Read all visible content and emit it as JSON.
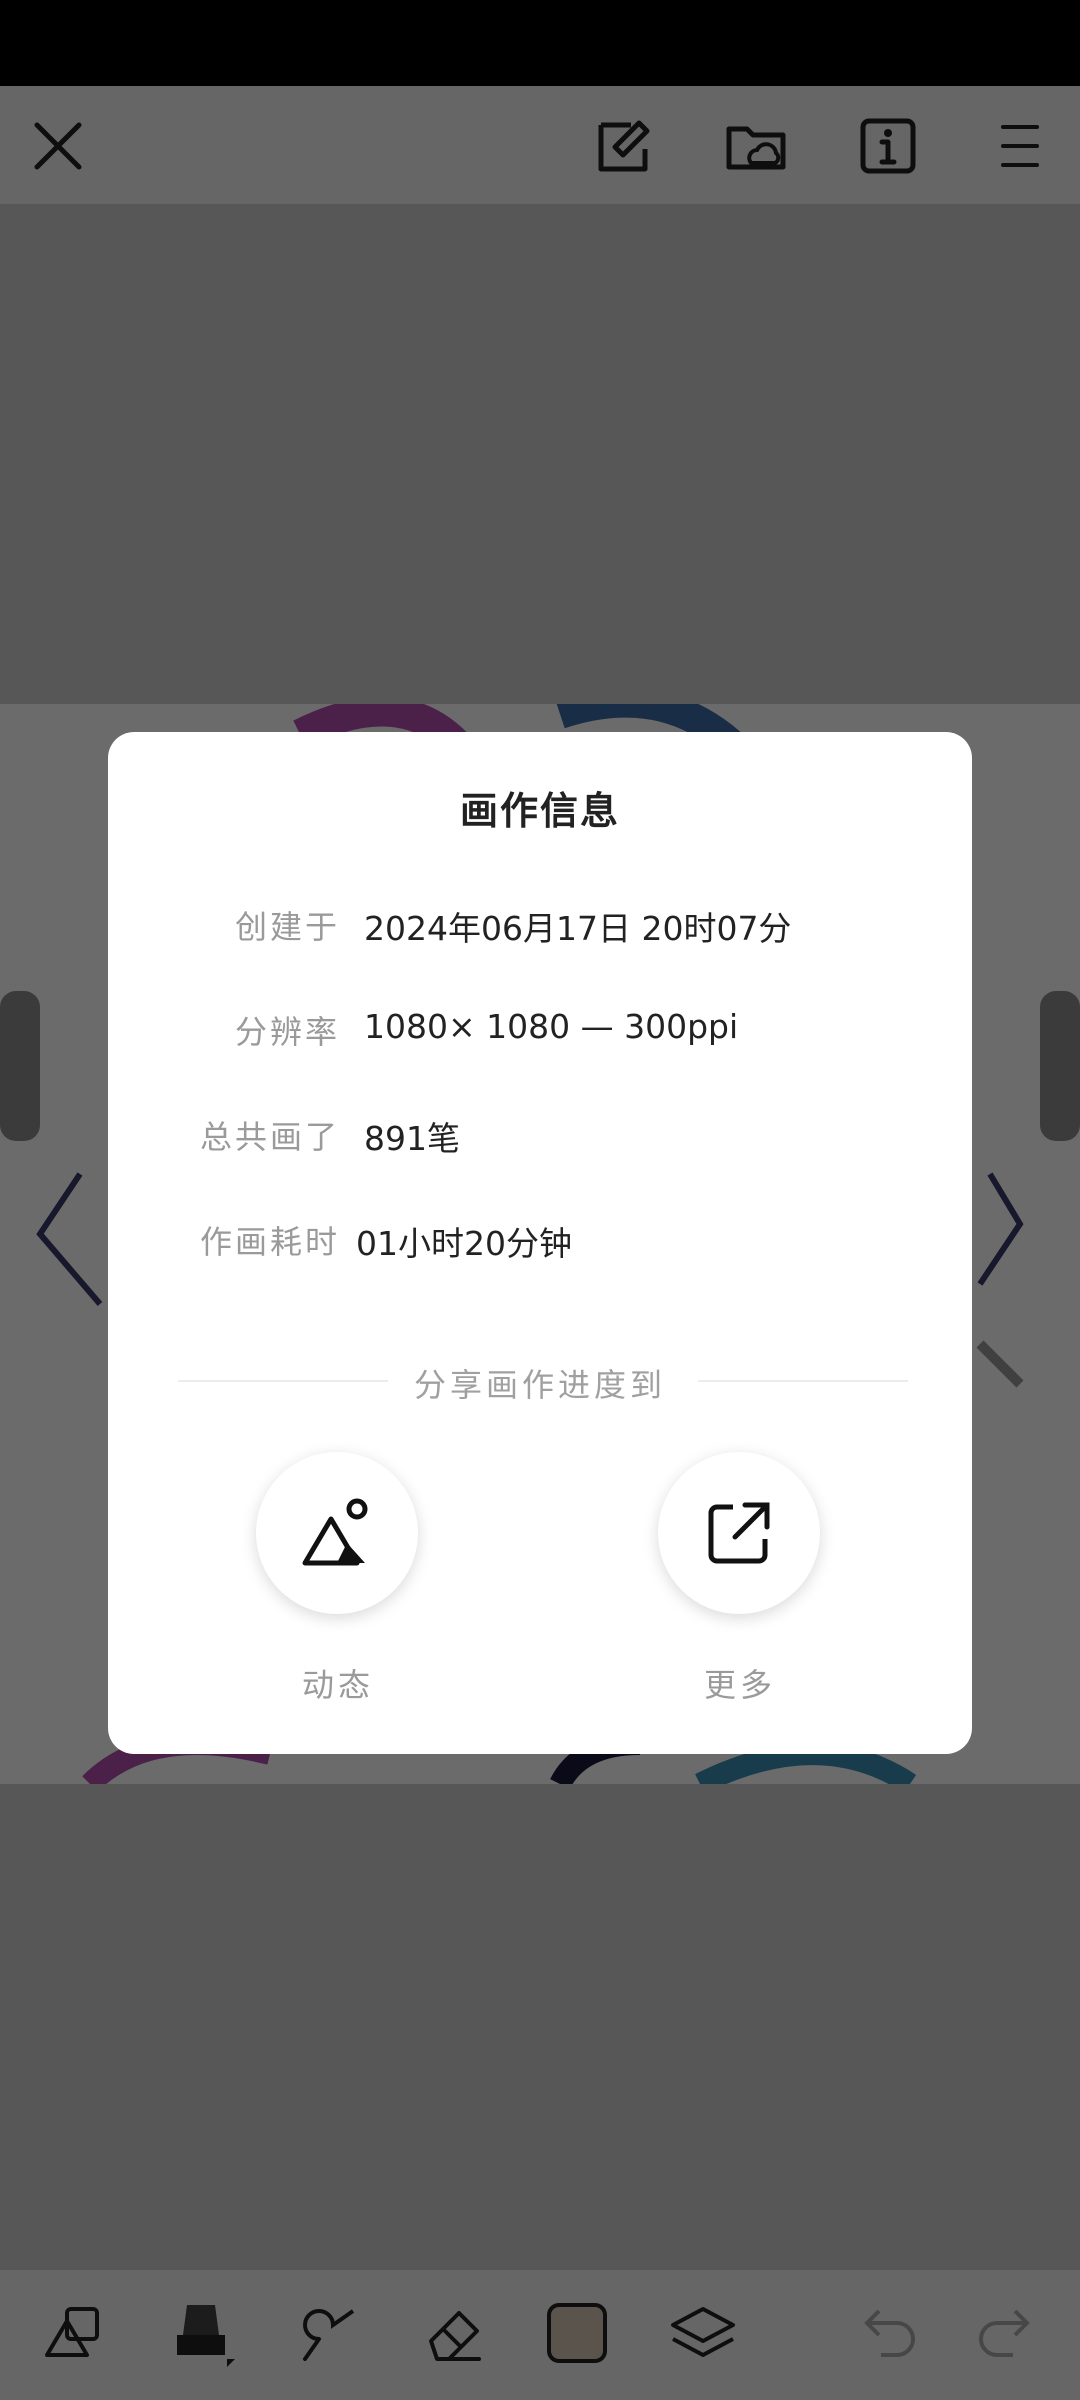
{
  "dialog": {
    "title": "画作信息",
    "rows": [
      {
        "label": "创建于",
        "value": "2024年06月17日 20时07分"
      },
      {
        "label": "分辨率",
        "value": "1080× 1080 — 300ppi"
      },
      {
        "label": "总共画了",
        "value": "891笔"
      },
      {
        "label": "作画耗时",
        "value": "01小时20分钟"
      }
    ],
    "share_title": "分享画作进度到",
    "share_items": [
      {
        "label": "动态",
        "icon": "mountain-image-icon"
      },
      {
        "label": "更多",
        "icon": "external-share-icon"
      }
    ]
  },
  "toolbar_top": {
    "icons": [
      "close-icon",
      "edit-note-icon",
      "cloud-folder-icon",
      "info-icon",
      "menu-icon"
    ]
  },
  "toolbar_bottom": {
    "icons": [
      "shapes-icon",
      "brush-icon",
      "smudge-icon",
      "eraser-icon",
      "color-swatch-icon",
      "layers-icon",
      "undo-icon",
      "redo-icon"
    ],
    "current_color": "#d9c8b8"
  }
}
